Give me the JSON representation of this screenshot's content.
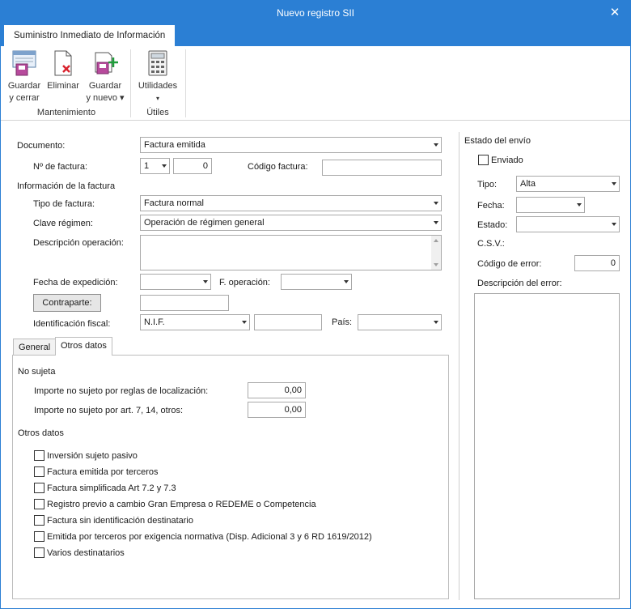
{
  "window": {
    "title": "Nuevo registro SII"
  },
  "ribbon": {
    "tab": "Suministro Inmediato de Información",
    "buttons": {
      "guardar_cerrar": [
        "Guardar",
        "y cerrar"
      ],
      "eliminar": "Eliminar",
      "guardar_nuevo": [
        "Guardar",
        "y nuevo ▾"
      ],
      "utilidades": "Utilidades"
    },
    "groups": {
      "mantenimiento": "Mantenimiento",
      "utiles": "Útiles"
    }
  },
  "form": {
    "documento_label": "Documento:",
    "documento_value": "Factura emitida",
    "num_factura_label": "Nº de factura:",
    "num_serie": "1",
    "num_value": "0",
    "codigo_factura_label": "Código factura:",
    "codigo_factura_value": "",
    "info_factura_label": "Información de la factura",
    "tipo_factura_label": "Tipo de factura:",
    "tipo_factura_value": "Factura normal",
    "clave_regimen_label": "Clave régimen:",
    "clave_regimen_value": "Operación de régimen general",
    "descripcion_label": "Descripción operación:",
    "descripcion_value": "",
    "fecha_expedicion_label": "Fecha de expedición:",
    "fecha_expedicion_value": "",
    "f_operacion_label": "F. operación:",
    "f_operacion_value": "",
    "contraparte_button": "Contraparte:",
    "contraparte_value": "",
    "identificacion_label": "Identificación fiscal:",
    "identificacion_value": "N.I.F.",
    "identificacion_number": "",
    "pais_label": "País:",
    "pais_value": ""
  },
  "tabs": [
    {
      "label": "General",
      "active": false
    },
    {
      "label": "Otros datos",
      "active": true
    }
  ],
  "otros": {
    "no_sujeta_label": "No sujeta",
    "importe_localizacion_label": "Importe no sujeto por reglas de localización:",
    "importe_localizacion_value": "0,00",
    "importe_art_label": "Importe no sujeto por art. 7, 14, otros:",
    "importe_art_value": "0,00",
    "otros_datos_label": "Otros datos",
    "checkboxes": [
      "Inversión sujeto pasivo",
      "Factura emitida por terceros",
      "Factura simplificada Art 7.2 y 7.3",
      "Registro previo a cambio Gran Empresa o REDEME o Competencia",
      "Factura sin identificación destinatario",
      "Emitida por terceros por exigencia normativa (Disp. Adicional 3 y 6 RD 1619/2012)",
      "Varios destinatarios"
    ]
  },
  "estado": {
    "title": "Estado del envío",
    "enviado_label": "Enviado",
    "tipo_label": "Tipo:",
    "tipo_value": "Alta",
    "fecha_label": "Fecha:",
    "fecha_value": "",
    "estado_label": "Estado:",
    "estado_value": "",
    "csv_label": "C.S.V.:",
    "codigo_error_label": "Código de error:",
    "codigo_error_value": "0",
    "descripcion_error_label": "Descripción del error:",
    "descripcion_error_value": ""
  },
  "colors": {
    "accent": "#2b7fd4",
    "border": "#a9a9a9"
  }
}
